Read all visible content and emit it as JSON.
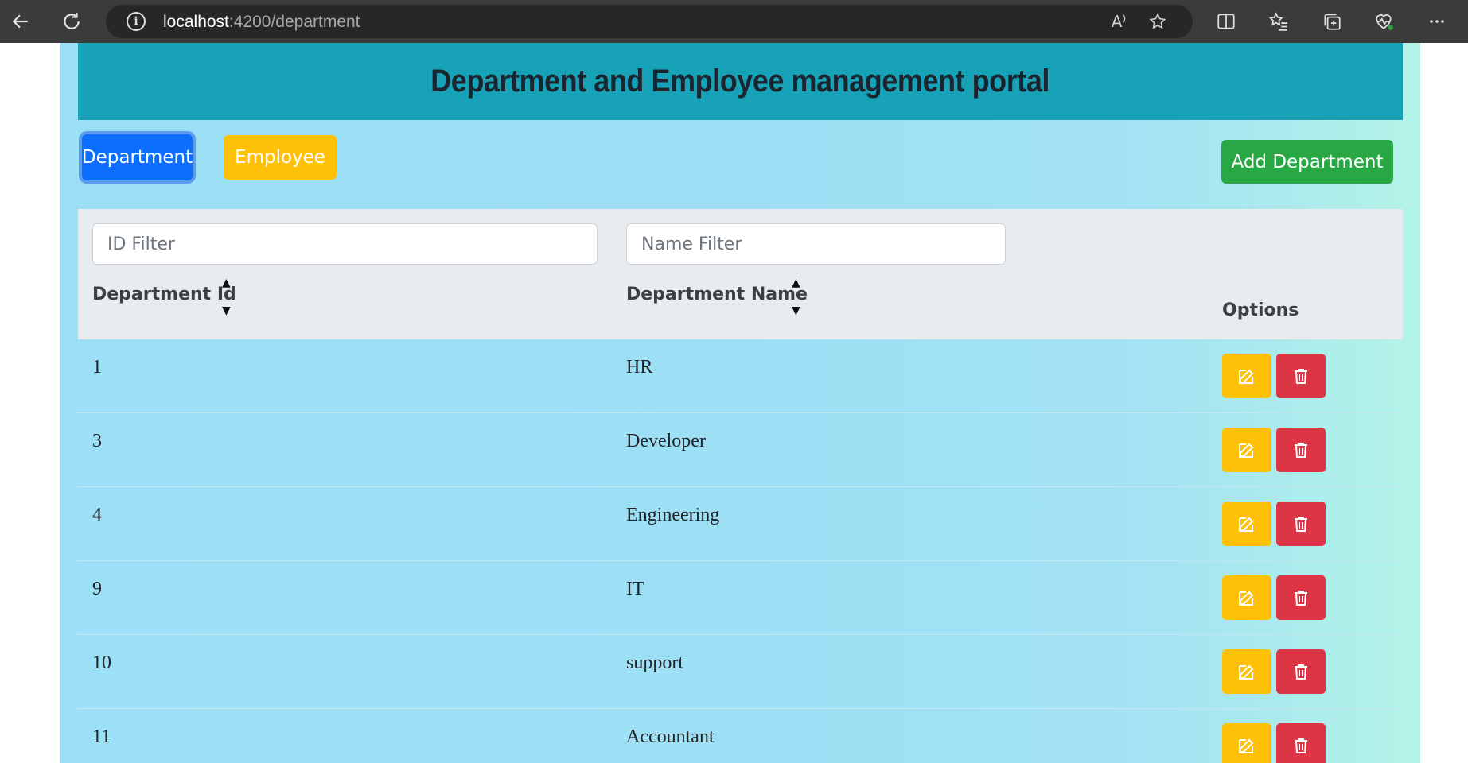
{
  "browser": {
    "url_host": "localhost",
    "url_rest": ":4200/department",
    "info_glyph": "i",
    "read_aloud_glyph": "A⁾"
  },
  "header": {
    "title": "Department and Employee management portal"
  },
  "nav": {
    "department_label": "Department",
    "employee_label": "Employee",
    "add_label": "Add Department"
  },
  "filters": {
    "id_placeholder": "ID Filter",
    "name_placeholder": "Name Filter"
  },
  "table": {
    "columns": [
      "Department Id",
      "Department Name",
      "Options"
    ],
    "rows": [
      {
        "id": "1",
        "name": "HR"
      },
      {
        "id": "3",
        "name": "Developer"
      },
      {
        "id": "4",
        "name": "Engineering"
      },
      {
        "id": "9",
        "name": "IT"
      },
      {
        "id": "10",
        "name": "support"
      },
      {
        "id": "11",
        "name": "Accountant"
      }
    ]
  },
  "icons": {
    "back": "back-arrow-icon",
    "refresh": "refresh-icon",
    "info": "info-icon",
    "read_aloud": "read-aloud-icon",
    "favorite": "star-icon",
    "split": "split-screen-icon",
    "favorites": "favorites-icon",
    "collections": "collections-icon",
    "health": "browser-essentials-icon",
    "more": "more-icon",
    "edit": "edit-icon",
    "delete": "trash-icon",
    "sort_up": "sort-up-icon",
    "sort_down": "sort-down-icon"
  },
  "colors": {
    "header": "#17a2b8",
    "primary": "#0d6efd",
    "warning": "#ffc107",
    "success": "#28a745",
    "danger": "#dc3545"
  }
}
